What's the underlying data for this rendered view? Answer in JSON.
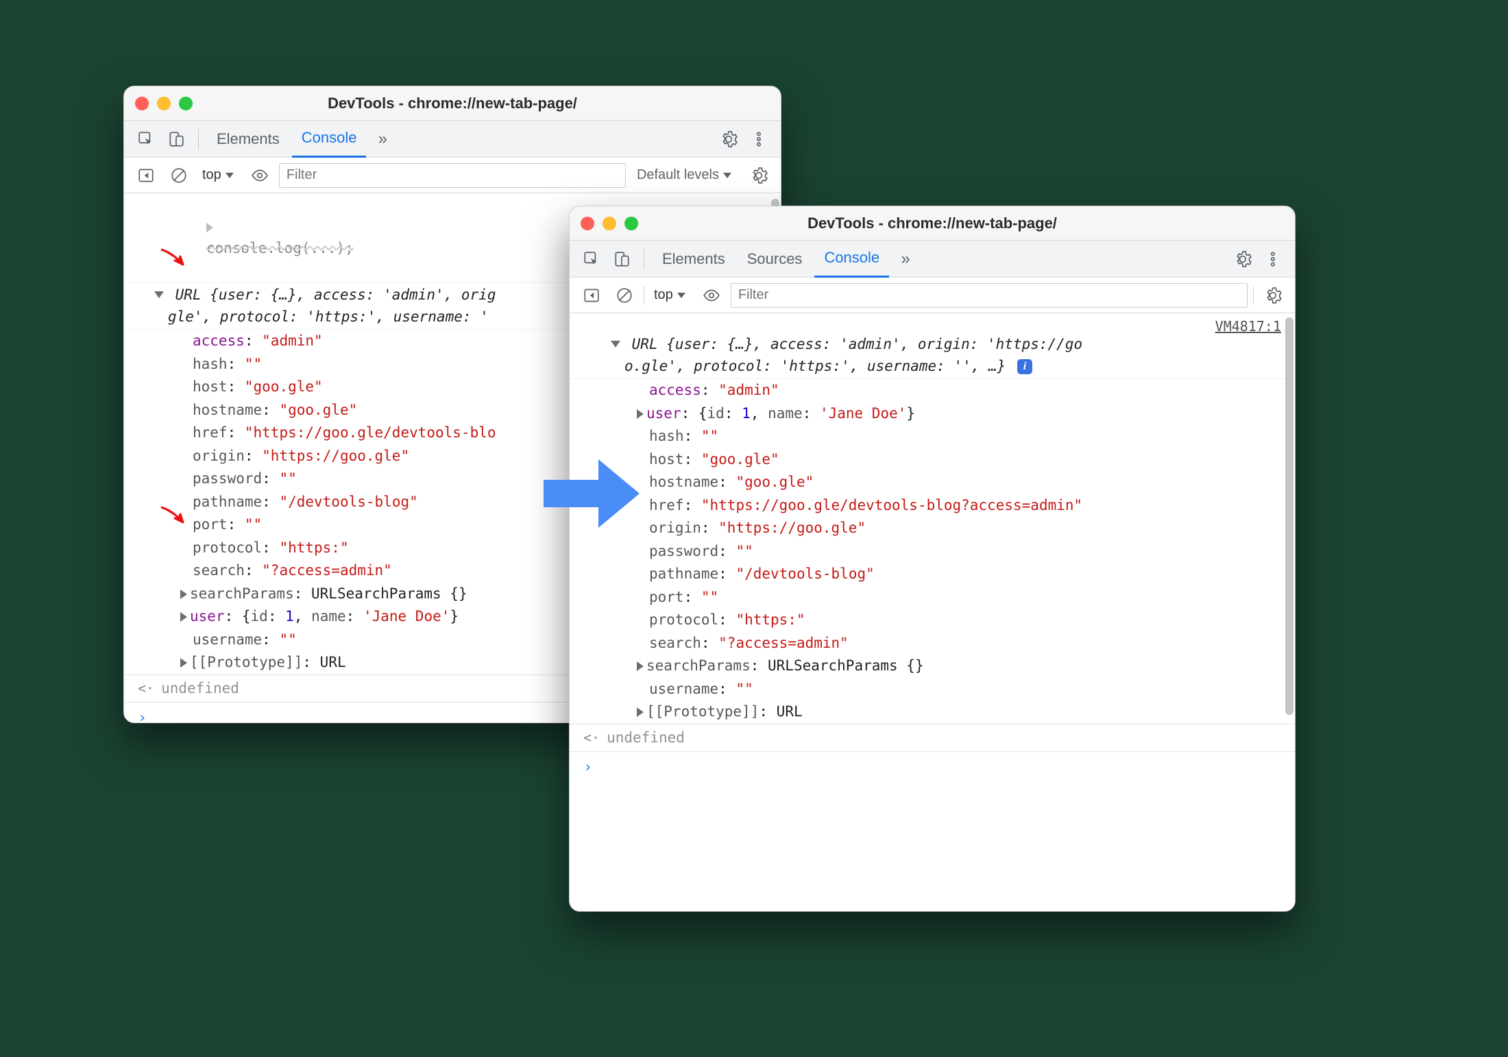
{
  "window1": {
    "title": "DevTools - chrome://new-tab-page/",
    "tabs": {
      "elements": "Elements",
      "console": "Console"
    },
    "toolbar": {
      "context": "top",
      "filter_placeholder": "Filter",
      "levels": "Default levels"
    },
    "cut_row": "console.log(...);",
    "summary": {
      "class": "URL",
      "line1": " {user: {…}, access: 'admin', orig",
      "line2": "gle', protocol: 'https:', username: '"
    },
    "props": {
      "access": {
        "k": "access",
        "v": "\"admin\""
      },
      "hash": {
        "k": "hash",
        "v": "\"\""
      },
      "host": {
        "k": "host",
        "v": "\"goo.gle\""
      },
      "hostname": {
        "k": "hostname",
        "v": "\"goo.gle\""
      },
      "href": {
        "k": "href",
        "v": "\"https://goo.gle/devtools-blo"
      },
      "origin": {
        "k": "origin",
        "v": "\"https://goo.gle\""
      },
      "password": {
        "k": "password",
        "v": "\"\""
      },
      "pathname": {
        "k": "pathname",
        "v": "\"/devtools-blog\""
      },
      "port": {
        "k": "port",
        "v": "\"\""
      },
      "protocol": {
        "k": "protocol",
        "v": "\"https:\""
      },
      "search": {
        "k": "search",
        "v": "\"?access=admin\""
      },
      "searchParams": {
        "k": "searchParams",
        "v": "URLSearchParams {}"
      },
      "user": {
        "k": "user",
        "pre": "{",
        "idk": "id",
        "idv": "1",
        "namek": "name",
        "namev": "'Jane Doe'",
        "post": "}"
      },
      "username": {
        "k": "username",
        "v": "\"\""
      },
      "proto": {
        "k": "[[Prototype]]",
        "v": "URL"
      }
    },
    "undefined": "undefined"
  },
  "window2": {
    "title": "DevTools - chrome://new-tab-page/",
    "tabs": {
      "elements": "Elements",
      "sources": "Sources",
      "console": "Console"
    },
    "toolbar": {
      "context": "top",
      "filter_placeholder": "Filter"
    },
    "source_link": "VM4817:1",
    "summary": {
      "class": "URL",
      "line1": " {user: {…}, access: 'admin', origin: 'https://go",
      "line2": "o.gle', protocol: 'https:', username: '', …}"
    },
    "props": {
      "access": {
        "k": "access",
        "v": "\"admin\""
      },
      "user": {
        "k": "user",
        "pre": "{",
        "idk": "id",
        "idv": "1",
        "namek": "name",
        "namev": "'Jane Doe'",
        "post": "}"
      },
      "hash": {
        "k": "hash",
        "v": "\"\""
      },
      "host": {
        "k": "host",
        "v": "\"goo.gle\""
      },
      "hostname": {
        "k": "hostname",
        "v": "\"goo.gle\""
      },
      "href": {
        "k": "href",
        "v": "\"https://goo.gle/devtools-blog?access=admin\""
      },
      "origin": {
        "k": "origin",
        "v": "\"https://goo.gle\""
      },
      "password": {
        "k": "password",
        "v": "\"\""
      },
      "pathname": {
        "k": "pathname",
        "v": "\"/devtools-blog\""
      },
      "port": {
        "k": "port",
        "v": "\"\""
      },
      "protocol": {
        "k": "protocol",
        "v": "\"https:\""
      },
      "search": {
        "k": "search",
        "v": "\"?access=admin\""
      },
      "searchParams": {
        "k": "searchParams",
        "v": "URLSearchParams {}"
      },
      "username": {
        "k": "username",
        "v": "\"\""
      },
      "proto": {
        "k": "[[Prototype]]",
        "v": "URL"
      }
    },
    "undefined": "undefined"
  },
  "glyphs": {
    "more": "»",
    "caret_down": "▼",
    "prompt": "›",
    "return": "‹·"
  }
}
